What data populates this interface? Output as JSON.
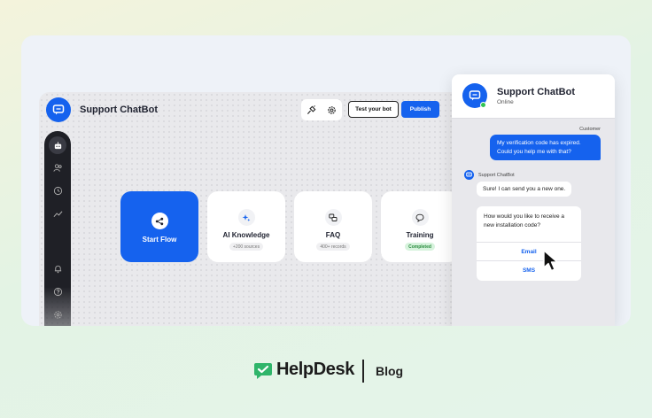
{
  "app": {
    "title": "Support ChatBot",
    "test_button": "Test your bot",
    "publish_button": "Publish"
  },
  "sidebar": {
    "items": [
      "bot-icon",
      "users-icon",
      "clock-icon",
      "analytics-icon",
      "bell-icon",
      "help-icon",
      "settings-icon"
    ]
  },
  "tiles": [
    {
      "label": "Start Flow",
      "badge": "",
      "icon": "flow-icon"
    },
    {
      "label": "AI Knowledge",
      "badge": "+200 sources",
      "icon": "sparkle-icon"
    },
    {
      "label": "FAQ",
      "badge": "400+ records",
      "icon": "faq-icon"
    },
    {
      "label": "Training",
      "badge": "Completed",
      "icon": "chat-bubble-icon"
    }
  ],
  "chat": {
    "title": "Support ChatBot",
    "status": "Online",
    "customer_label": "Customer",
    "customer_message": "My verification code has expired. Could you help me with that?",
    "bot_name": "Support ChatBot",
    "bot_reply": "Sure! I can send you a new one.",
    "bot_question": "How would you like to receive a new installation code?",
    "options": [
      "Email",
      "SMS"
    ]
  },
  "footer": {
    "brand": "HelpDesk",
    "section": "Blog"
  },
  "colors": {
    "accent": "#1562ee",
    "sidebar": "#1f2026",
    "online": "#2fc353",
    "brand_green": "#2fb56a"
  }
}
